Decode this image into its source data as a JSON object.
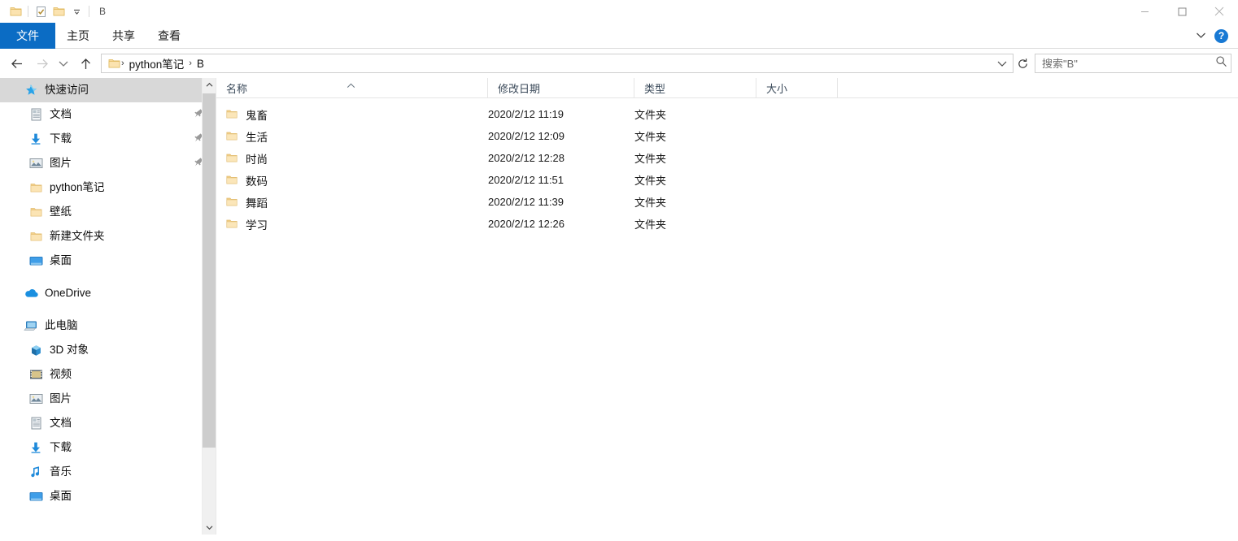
{
  "window": {
    "title": "B",
    "quick_access_toolbar": [
      {
        "name": "folder-system-menu-icon",
        "label": "属性菜单"
      },
      {
        "name": "properties-icon",
        "label": "属性"
      },
      {
        "name": "new-folder-icon",
        "label": "新建文件夹"
      },
      {
        "name": "chevron-down-icon",
        "label": "自定义快速访问工具栏"
      }
    ],
    "controls": {
      "minimize": "最小化",
      "maximize": "最大化",
      "close": "关闭"
    }
  },
  "ribbon": {
    "tabs": [
      {
        "label": "文件",
        "active": true
      },
      {
        "label": "主页",
        "active": false
      },
      {
        "label": "共享",
        "active": false
      },
      {
        "label": "查看",
        "active": false
      }
    ],
    "expand_label": "展开功能区",
    "help_label": "?"
  },
  "navigation": {
    "back": "后退",
    "forward": "前进",
    "recent": "最近位置",
    "up": "上一级",
    "breadcrumbs": [
      "python笔记",
      "B"
    ],
    "separator": "›",
    "refresh": "刷新"
  },
  "search": {
    "placeholder": "搜索\"B\"",
    "value": ""
  },
  "sidebar": {
    "groups": [
      {
        "header": {
          "label": "快速访问",
          "icon": "star-pin-icon",
          "selected": true
        },
        "items": [
          {
            "label": "文档",
            "icon": "documents-icon",
            "pinned": true
          },
          {
            "label": "下载",
            "icon": "downloads-icon",
            "pinned": true
          },
          {
            "label": "图片",
            "icon": "pictures-icon",
            "pinned": true
          },
          {
            "label": "python笔记",
            "icon": "folder-icon",
            "pinned": false
          },
          {
            "label": "壁纸",
            "icon": "folder-icon",
            "pinned": false
          },
          {
            "label": "新建文件夹",
            "icon": "folder-icon",
            "pinned": false
          },
          {
            "label": "桌面",
            "icon": "desktop-icon",
            "pinned": false
          }
        ]
      },
      {
        "header": {
          "label": "OneDrive",
          "icon": "onedrive-cloud-icon",
          "selected": false
        },
        "items": []
      },
      {
        "header": {
          "label": "此电脑",
          "icon": "this-pc-icon",
          "selected": false
        },
        "items": [
          {
            "label": "3D 对象",
            "icon": "3d-objects-icon",
            "pinned": false
          },
          {
            "label": "视频",
            "icon": "videos-icon",
            "pinned": false
          },
          {
            "label": "图片",
            "icon": "pictures-icon",
            "pinned": false
          },
          {
            "label": "文档",
            "icon": "documents-icon",
            "pinned": false
          },
          {
            "label": "下载",
            "icon": "downloads-icon",
            "pinned": false
          },
          {
            "label": "音乐",
            "icon": "music-icon",
            "pinned": false
          },
          {
            "label": "桌面",
            "icon": "desktop-icon",
            "pinned": false
          }
        ]
      }
    ],
    "scrollbar": {
      "up": "向上滚动",
      "down": "向下滚动"
    }
  },
  "file_list": {
    "columns": [
      {
        "label": "名称",
        "sorted": "asc"
      },
      {
        "label": "修改日期",
        "sorted": ""
      },
      {
        "label": "类型",
        "sorted": ""
      },
      {
        "label": "大小",
        "sorted": ""
      }
    ],
    "rows": [
      {
        "name": "鬼畜",
        "date": "2020/2/12 11:19",
        "type": "文件夹",
        "size": ""
      },
      {
        "name": "生活",
        "date": "2020/2/12 12:09",
        "type": "文件夹",
        "size": ""
      },
      {
        "name": "时尚",
        "date": "2020/2/12 12:28",
        "type": "文件夹",
        "size": ""
      },
      {
        "name": "数码",
        "date": "2020/2/12 11:51",
        "type": "文件夹",
        "size": ""
      },
      {
        "name": "舞蹈",
        "date": "2020/2/12 11:39",
        "type": "文件夹",
        "size": ""
      },
      {
        "name": "学习",
        "date": "2020/2/12 12:26",
        "type": "文件夹",
        "size": ""
      }
    ]
  },
  "colors": {
    "accent": "#0b6cc4",
    "selection": "#d8d8d8",
    "folder_yellow": "#f6d488",
    "header_text": "#3b4a5a"
  }
}
